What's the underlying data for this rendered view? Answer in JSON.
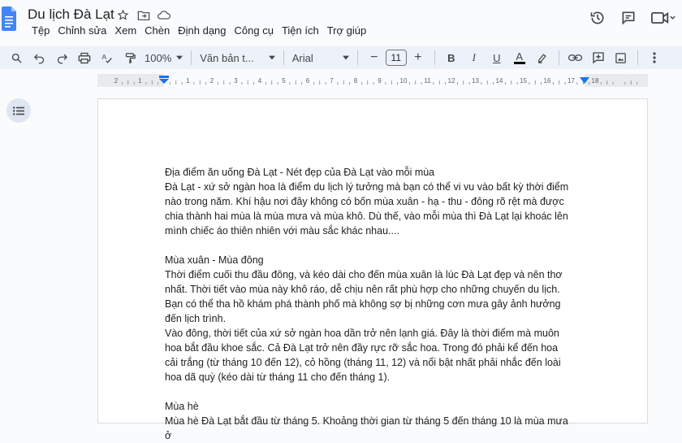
{
  "app": {
    "title": "Du lịch Đà Lạt",
    "brand_color": "#4285f4"
  },
  "menu": [
    "Tệp",
    "Chỉnh sửa",
    "Xem",
    "Chèn",
    "Định dạng",
    "Công cụ",
    "Tiện ích",
    "Trợ giúp"
  ],
  "toolbar": {
    "zoom": "100%",
    "style": "Văn bản t...",
    "font": "Arial",
    "font_size": "11",
    "minus": "−",
    "plus": "+",
    "bold": "B",
    "italic": "I",
    "underline": "U",
    "text_color": "A"
  },
  "document": {
    "paragraphs": [
      "Địa điểm ăn uống Đà Lạt - Nét đẹp của Đà Lạt vào mỗi mùa",
      "Đà Lạt - xứ sở ngàn hoa là điểm du lịch lý tưởng mà bạn có thể vi vu vào bất kỳ thời điểm nào trong năm. Khí hậu nơi đây không có bốn mùa xuân - hạ - thu - đông rõ rệt mà được chia thành hai mùa là mùa mưa và mùa khô. Dù thế, vào mỗi mùa thì Đà Lạt lại khoác lên mình chiếc áo thiên nhiên với màu sắc khác nhau....",
      "",
      "Mùa xuân - Mùa đông",
      "Thời điểm cuối thu đầu đông, và kéo dài cho đến mùa xuân là lúc Đà Lạt đẹp và nên thơ nhất. Thời tiết vào mùa này khô ráo, dễ chịu nên rất phù hợp cho những chuyến du lịch. Bạn có thể tha hồ khám phá thành phố mà không sợ bị những cơn mưa gây ảnh hưởng đến lịch trình.",
      "Vào đông, thời tiết của xứ sở ngàn hoa dần trở nên lạnh giá. Đây là thời điểm mà muôn hoa bắt đầu khoe sắc. Cả Đà Lạt trở nên đầy rực rỡ sắc hoa. Trong đó phải kể đến hoa cải trắng (từ tháng 10 đến 12), cỏ hồng (tháng 11, 12) và nổi bật nhất phải nhắc đến loài hoa dã quỳ (kéo dài từ tháng 11 cho đến tháng 1).",
      "",
      "Mùa hè",
      "Mùa hè Đà Lạt bắt đầu từ tháng 5. Khoảng thời gian từ tháng 5 đến tháng 10 là mùa mưa ở"
    ]
  }
}
